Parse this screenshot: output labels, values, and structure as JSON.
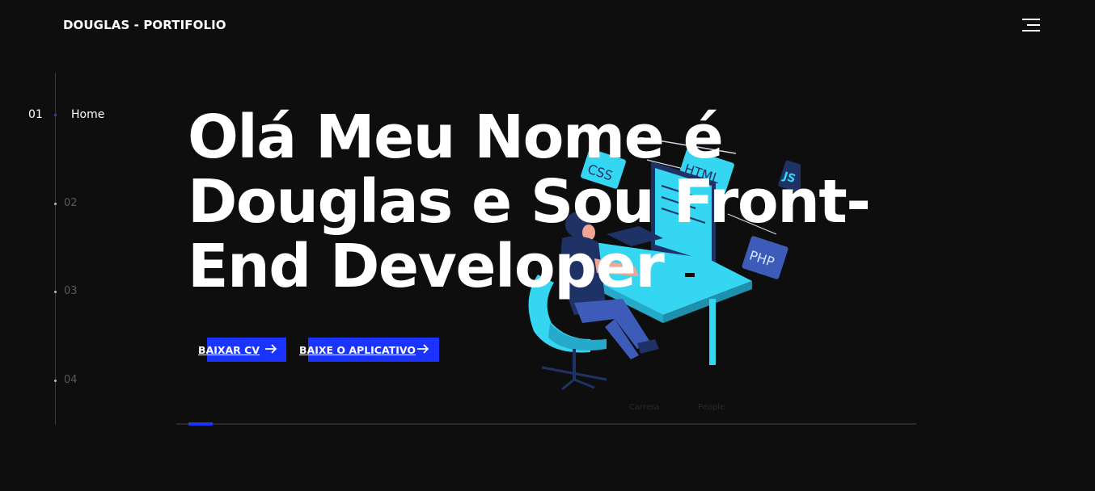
{
  "header": {
    "logo": "DOUGLAS - PORTIFOLIO",
    "menu_icon": "hamburger-menu-icon"
  },
  "sidebar": {
    "active": {
      "number": "01",
      "label": "Home"
    },
    "items": [
      {
        "number": "02"
      },
      {
        "number": "03"
      },
      {
        "number": "04"
      }
    ]
  },
  "hero": {
    "title_lines": [
      "Olá Meu Nome é",
      "Douglas e Sou Front-",
      "End Developer"
    ],
    "buttons": [
      {
        "label": "BAIXAR CV",
        "icon": "arrow-right-icon"
      },
      {
        "label": "BAIXE O APLICATIVO",
        "icon": "arrow-right-icon"
      }
    ],
    "illustration_labels": [
      "CSS",
      "HTML",
      "JS",
      "PHP"
    ],
    "faint_texts": [
      "Carrera",
      "People"
    ]
  },
  "scroll": {
    "progress": 0.033
  },
  "colors": {
    "background": "#0f0e0f",
    "accent": "#1b33ff",
    "illustration_cyan": "#35d6f2",
    "illustration_navy": "#1e3266"
  }
}
